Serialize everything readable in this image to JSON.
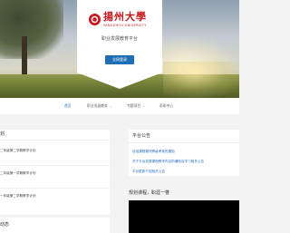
{
  "header": {
    "university_name": "揚州大學",
    "university_en": "YANGZHOU UNIVERSITY",
    "platform_title": "职业发展教育平台",
    "login_button": "全网登录"
  },
  "nav": {
    "items": [
      {
        "label": "首页",
        "has_dropdown": false,
        "active": true
      },
      {
        "label": "职业发展教育",
        "has_dropdown": true,
        "active": false
      },
      {
        "label": "专题项目",
        "has_dropdown": true,
        "active": false
      },
      {
        "label": "帮助中心",
        "has_dropdown": false,
        "active": false
      }
    ]
  },
  "plans": {
    "title": "划",
    "items": [
      "二年级第二学期教学计划",
      "二年级第一学期教学计划",
      "一年级第二学期教学计划"
    ]
  },
  "dynamics": {
    "title": "动态"
  },
  "announcements": {
    "title": "平台公告",
    "items": [
      "包括课程模块等级考核的通知",
      "关于平台发展课程教学内容的通知及学习相关公告",
      "平台更新介绍相关公告"
    ]
  },
  "video": {
    "title": "规划课程，职涯一瞥"
  },
  "colors": {
    "brand_red": "#c8161d",
    "primary_blue": "#1f6fb5",
    "link_blue": "#2a6fba"
  }
}
